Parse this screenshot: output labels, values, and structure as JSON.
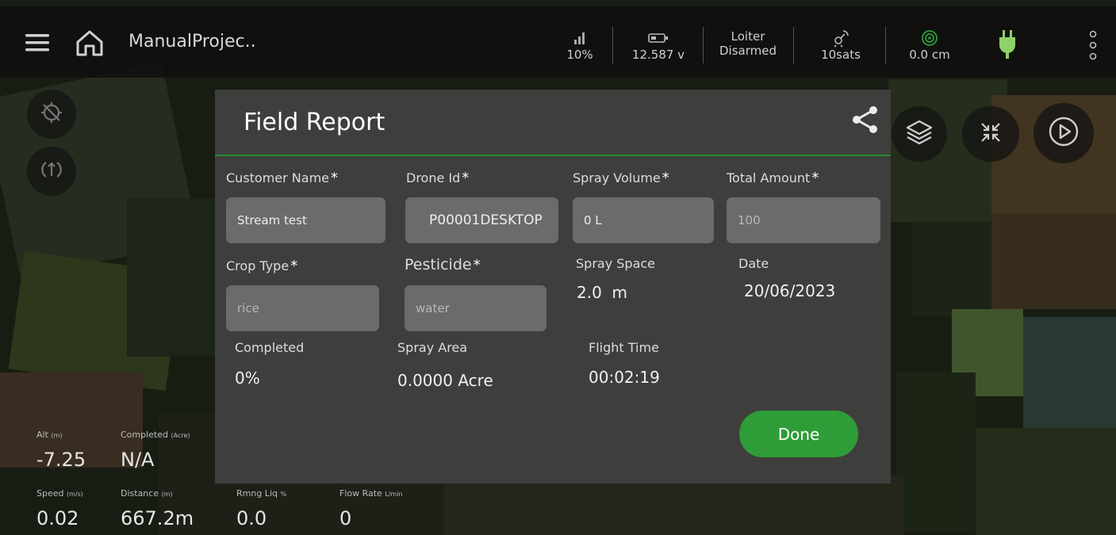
{
  "app": {
    "project_title": "ManualProjec.."
  },
  "status_bar": {
    "signal_percent": "10%",
    "voltage": "12.587 v",
    "flight_mode": "Loiter",
    "arm_state": "Disarmed",
    "satellites": "10sats",
    "radar_distance": "0.0 cm"
  },
  "telemetry": {
    "alt_label": "Alt",
    "alt_unit": "(m)",
    "alt_value": "-7.25",
    "completed_label": "Completed",
    "completed_unit": "(Acre)",
    "completed_value": "N/A",
    "speed_label": "Speed",
    "speed_unit": "(m/s)",
    "speed_value": "0.02",
    "distance_label": "Distance",
    "distance_unit": "(m)",
    "distance_value": "667.2m",
    "rmng_liq_label": "Rmng Liq",
    "rmng_liq_unit": "%",
    "rmng_liq_value": "0.0",
    "flow_rate_label": "Flow Rate",
    "flow_rate_unit": "L/min",
    "flow_rate_value": "0"
  },
  "dialog": {
    "title": "Field Report",
    "required_mark": "*",
    "customer_name": {
      "label": "Customer Name",
      "value": "Stream test"
    },
    "drone_id": {
      "label": "Drone Id",
      "value": "P00001DESKTOP"
    },
    "spray_volume": {
      "label": "Spray Volume",
      "value": "0 L"
    },
    "total_amount": {
      "label": "Total Amount",
      "placeholder": "100"
    },
    "crop_type": {
      "label": "Crop Type",
      "placeholder": "rice"
    },
    "pesticide": {
      "label": "Pesticide",
      "placeholder": "water"
    },
    "spray_space": {
      "label": "Spray Space",
      "value": "2.0  m"
    },
    "date": {
      "label": "Date",
      "value": "20/06/2023"
    },
    "completed": {
      "label": "Completed",
      "value": "0%"
    },
    "spray_area": {
      "label": "Spray Area",
      "value": "0.0000 Acre"
    },
    "flight_time": {
      "label": "Flight Time",
      "value": "00:02:19"
    },
    "done_label": "Done"
  },
  "colors": {
    "accent_green": "#2e9d37",
    "header_divider": "#1f8a31",
    "dialog_bg": "#3e3f3c",
    "input_bg": "#6b6c69",
    "plug_icon": "#8fd16a",
    "radar_icon": "#2e9d37"
  },
  "icons": {
    "menu": "menu-icon",
    "home": "home-icon",
    "signal": "signal-icon",
    "battery": "battery-icon",
    "satellite": "satellite-icon",
    "radar": "radar-icon",
    "plug": "plug-icon",
    "more": "more-vertical-icon",
    "share": "share-icon",
    "layers": "layers-icon",
    "collapse": "collapse-icon",
    "play": "play-icon",
    "gps_off": "gps-off-icon",
    "rotate": "rotate-icon"
  }
}
